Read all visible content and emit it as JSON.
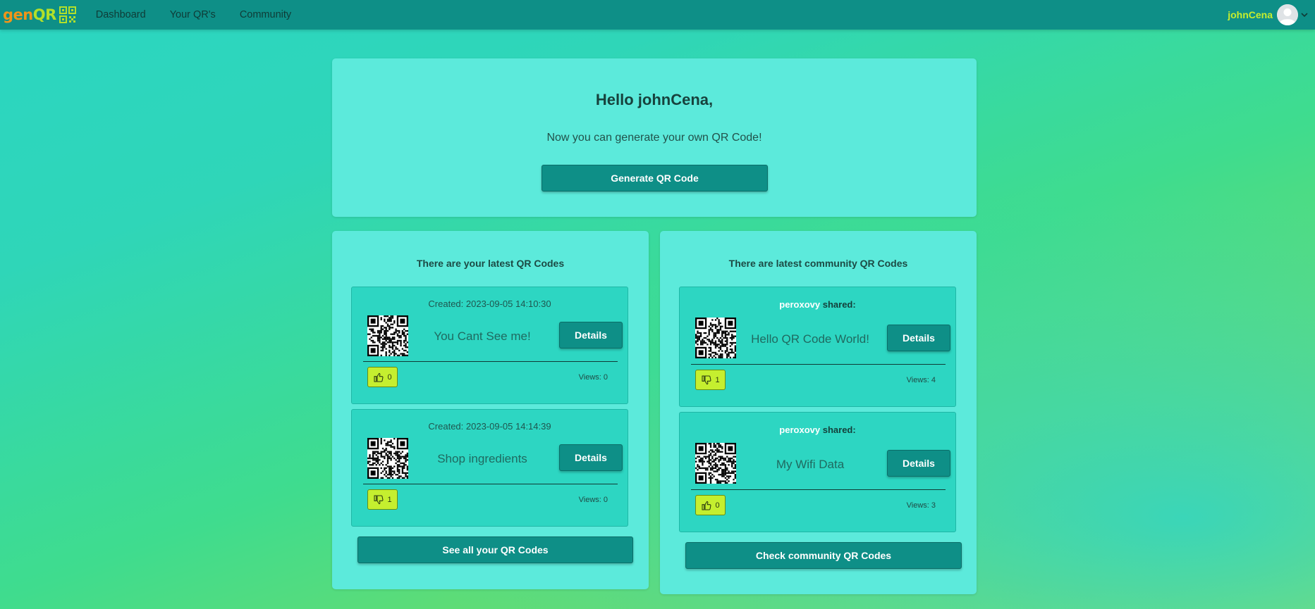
{
  "app": {
    "logo_text_gen": "gen",
    "logo_text_qr": "QR"
  },
  "nav": {
    "links": [
      "Dashboard",
      "Your QR's",
      "Community"
    ]
  },
  "user": {
    "name": "johnCena"
  },
  "hello": {
    "title": "Hello johnCena,",
    "subtitle": "Now you can generate your own QR Code!",
    "button": "Generate QR Code"
  },
  "my_codes": {
    "title": "There are your latest QR Codes",
    "items": [
      {
        "header": "Created: 2023-09-05 14:10:30",
        "name": "You Cant See me!",
        "details": "Details",
        "vote_icon": "thumbs-up-icon",
        "votes": "0",
        "views": "Views: 0"
      },
      {
        "header": "Created: 2023-09-05 14:14:39",
        "name": "Shop ingredients",
        "details": "Details",
        "vote_icon": "thumbs-down-icon",
        "votes": "1",
        "views": "Views: 0"
      }
    ],
    "button": "See all your QR Codes"
  },
  "community": {
    "title": "There are latest community QR Codes",
    "items": [
      {
        "sharer": "peroxovy",
        "shared_text": "shared:",
        "name": "Hello QR Code World!",
        "details": "Details",
        "vote_icon": "thumbs-down-icon",
        "votes": "1",
        "views": "Views: 4"
      },
      {
        "sharer": "peroxovy",
        "shared_text": "shared:",
        "name": "My Wifi Data",
        "details": "Details",
        "vote_icon": "thumbs-up-icon",
        "votes": "0",
        "views": "Views: 3"
      }
    ],
    "button": "Check community QR Codes"
  },
  "colors": {
    "navbar": "#0e8f87",
    "card": "#5ceadb",
    "item": "#2dd6c2",
    "accent": "#c5ef2f",
    "logo_orange": "#f0951a"
  }
}
